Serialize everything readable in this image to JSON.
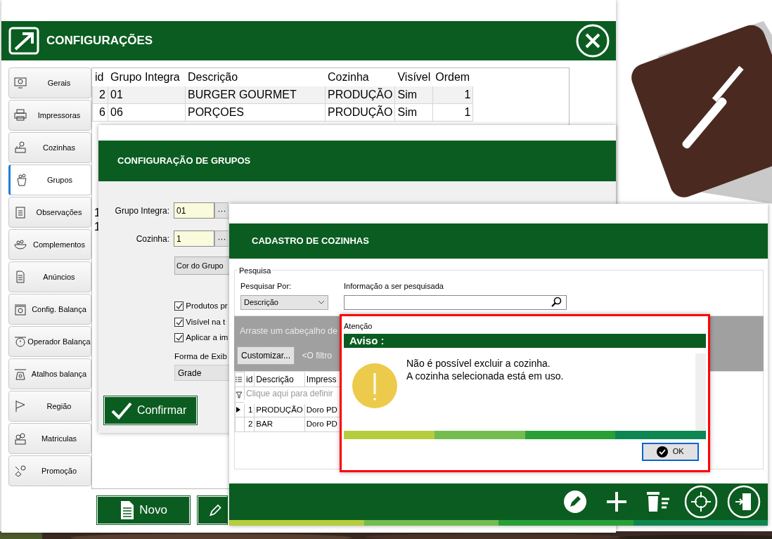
{
  "window": {
    "title": "CONFIGURAÇÕES"
  },
  "sidebar": {
    "items": [
      {
        "label": "Gerais",
        "selected": false
      },
      {
        "label": "Impressoras",
        "selected": false
      },
      {
        "label": "Cozinhas",
        "selected": false
      },
      {
        "label": "Grupos",
        "selected": true
      },
      {
        "label": "Observações",
        "selected": false
      },
      {
        "label": "Complementos",
        "selected": false
      },
      {
        "label": "Anúncios",
        "selected": false
      },
      {
        "label": "Config. Balança",
        "selected": false
      },
      {
        "label": "Operador  Balança",
        "selected": false
      },
      {
        "label": "Atalhos balança",
        "selected": false
      },
      {
        "label": "Região",
        "selected": false
      },
      {
        "label": "Matriculas",
        "selected": false
      },
      {
        "label": "Promoção",
        "selected": false
      }
    ]
  },
  "table": {
    "columns": [
      "id",
      "Grupo Integra",
      "Descrição",
      "Cozinha",
      "Visível",
      "Ordem"
    ],
    "rows": [
      {
        "cells": [
          "2",
          "01",
          "BURGER GOURMET",
          "PRODUÇÃO",
          "Sim",
          "1"
        ]
      },
      {
        "cells": [
          "6",
          "06",
          "PORÇOES",
          "PRODUÇÃO",
          "Sim",
          "1"
        ]
      }
    ],
    "partial_rows": [
      {
        "id": "1"
      },
      {
        "id": "1"
      }
    ]
  },
  "footer_buttons": [
    {
      "label": "Novo"
    }
  ],
  "group_dialog": {
    "title": "CONFIGURAÇÃO DE GRUPOS",
    "fields": [
      {
        "label": "Grupo Integra:",
        "value": "01",
        "button": "···"
      },
      {
        "label": "Cozinha:",
        "value": "1",
        "button": "···"
      }
    ],
    "color_button": "Cor do Grupo",
    "checkboxes": [
      {
        "label": "Produtos pr",
        "checked": true
      },
      {
        "label": "Visível na t",
        "checked": true
      },
      {
        "label": "Aplicar a im",
        "checked": true
      }
    ],
    "display": {
      "label": "Forma de Exib",
      "value": "Grade"
    },
    "confirm_button": "Confirmar"
  },
  "kitchen_window": {
    "title": "CADASTRO DE COZINHAS",
    "search": {
      "legend": "Pesquisa",
      "by_label": "Pesquisar Por:",
      "by_value": "Descrição",
      "info_label": "Informação a ser pesquisada"
    },
    "group_panel_hint": "Arraste um cabeçalho de",
    "customize_button": "Customizar...",
    "filter_text": "<O filtro",
    "grid": {
      "columns": [
        "id",
        "Descrição",
        "Impress"
      ],
      "filter_hint": "Clique aqui para definir",
      "rows": [
        {
          "cells": [
            "1",
            "PRODUÇÃO",
            "Doro PD"
          ],
          "selected": true
        },
        {
          "cells": [
            "2",
            "BAR",
            "Doro PD"
          ],
          "selected": false
        }
      ]
    }
  },
  "alert": {
    "window_title": "Atenção",
    "heading": "Aviso :",
    "message": [
      "Não é possível excluir a cozinha.",
      "A cozinha selecionada está em uso."
    ],
    "button": "OK"
  }
}
